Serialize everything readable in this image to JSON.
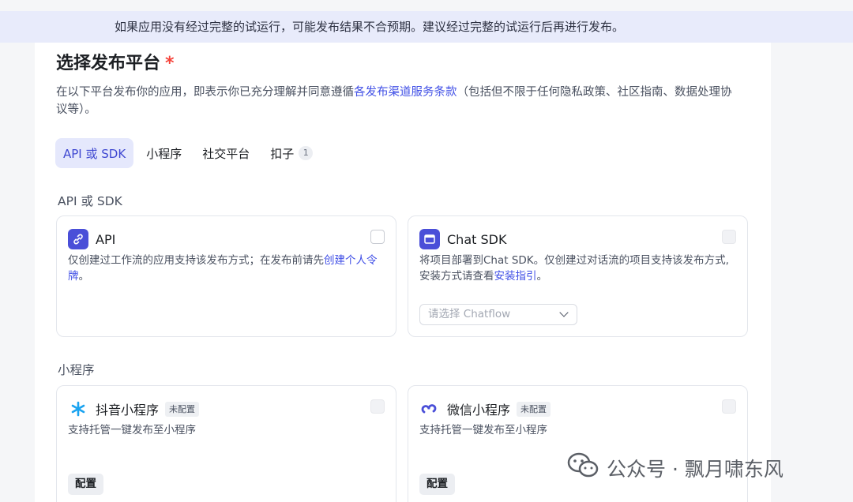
{
  "banner": {
    "text": "如果应用没有经过完整的试运行，可能发布结果不合预期。建议经过完整的试运行后再进行发布。"
  },
  "header": {
    "title": "选择发布平台",
    "required_mark": "*",
    "description_prefix": "在以下平台发布你的应用，即表示你已充分理解并同意遵循",
    "description_link": "各发布渠道服务条款",
    "description_suffix": "（包括但不限于任何隐私政策、社区指南、数据处理协议等）。"
  },
  "tabs": [
    {
      "label": "API 或 SDK",
      "active": true
    },
    {
      "label": "小程序",
      "active": false
    },
    {
      "label": "社交平台",
      "active": false
    },
    {
      "label": "扣子",
      "count": "1",
      "active": false
    }
  ],
  "sections": {
    "api_sdk": {
      "label": "API 或 SDK"
    },
    "mini_program": {
      "label": "小程序"
    }
  },
  "cards": {
    "api": {
      "title": "API",
      "icon": "link-icon",
      "desc_prefix": "仅创建过工作流的应用支持该发布方式；在发布前请先",
      "desc_link": "创建个人令牌",
      "desc_suffix": "。"
    },
    "chat_sdk": {
      "title": "Chat SDK",
      "icon": "window-icon",
      "desc_prefix": "将项目部署到Chat SDK。仅创建过对话流的项目支持该发布方式,安装方式请查看",
      "desc_link": "安装指引",
      "desc_suffix": "。",
      "select_placeholder": "请选择 Chatflow"
    },
    "douyin": {
      "title": "抖音小程序",
      "tag": "未配置",
      "icon": "douyin-icon",
      "desc": "支持托管一键发布至小程序",
      "button": "配置"
    },
    "wechat": {
      "title": "微信小程序",
      "tag": "未配置",
      "icon": "wechat-miniprogram-icon",
      "desc": "支持托管一键发布至小程序",
      "button": "配置"
    }
  },
  "watermark": {
    "text": "公众号 · 飘月啸东风"
  },
  "colors": {
    "accent": "#4150e6",
    "banner_bg": "#e8ebfb",
    "required": "#f5433a"
  }
}
